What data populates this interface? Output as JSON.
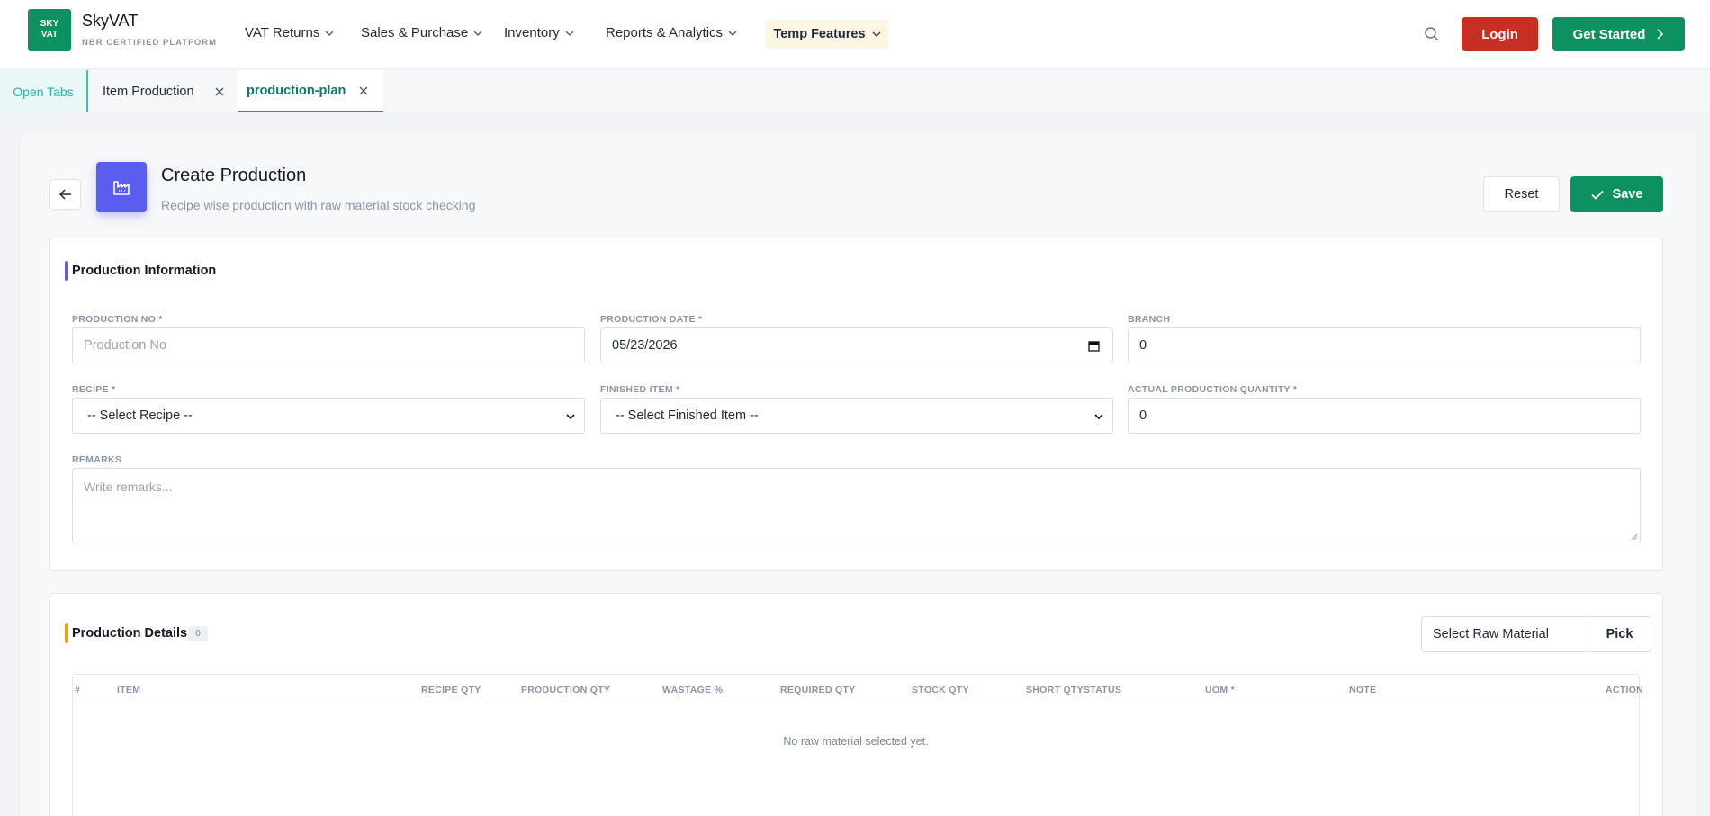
{
  "brand": {
    "logo_line1": "SKY",
    "logo_line2": "VAT",
    "name": "SkyVAT",
    "subtitle": "NBR CERTIFIED PLATFORM"
  },
  "nav": {
    "items": [
      {
        "label": "VAT Returns"
      },
      {
        "label": "Sales & Purchase"
      },
      {
        "label": "Inventory"
      },
      {
        "label": "Reports & Analytics"
      }
    ],
    "temp_features": "Temp Features",
    "login": "Login",
    "get_started": "Get Started"
  },
  "tabs": {
    "open_tabs": "Open Tabs",
    "items": [
      {
        "label": "Item Production",
        "active": false
      },
      {
        "label": "production-plan",
        "active": true
      }
    ]
  },
  "page": {
    "title": "Create Production",
    "subtitle": "Recipe wise production with raw material stock checking",
    "reset": "Reset",
    "save": "Save"
  },
  "production_info": {
    "title": "Production Information",
    "production_no": {
      "label": "PRODUCTION NO *",
      "placeholder": "Production No"
    },
    "production_date": {
      "label": "PRODUCTION DATE *",
      "value": "05/23/2026"
    },
    "branch": {
      "label": "BRANCH",
      "value": "0"
    },
    "recipe": {
      "label": "RECIPE *",
      "value": "-- Select Recipe --"
    },
    "finished_item": {
      "label": "FINISHED ITEM *",
      "value": "-- Select Finished Item --"
    },
    "actual_qty": {
      "label": "ACTUAL PRODUCTION QUANTITY *",
      "value": "0"
    },
    "remarks": {
      "label": "REMARKS",
      "placeholder": "Write remarks..."
    }
  },
  "production_details": {
    "title": "Production Details",
    "count": "0",
    "raw_select": "Select Raw Material",
    "pick": "Pick",
    "columns": [
      "#",
      "ITEM",
      "RECIPE QTY",
      "PRODUCTION QTY",
      "WASTAGE %",
      "REQUIRED QTY",
      "STOCK QTY",
      "SHORT QTYSTATUS",
      "UOM *",
      "NOTE",
      "ACTION"
    ],
    "empty_message": "No raw material selected yet."
  },
  "colors": {
    "primary_green": "#0e9160",
    "login_red": "#c62f22",
    "info_accent": "#5b5cf0",
    "details_accent": "#f59e0b"
  }
}
